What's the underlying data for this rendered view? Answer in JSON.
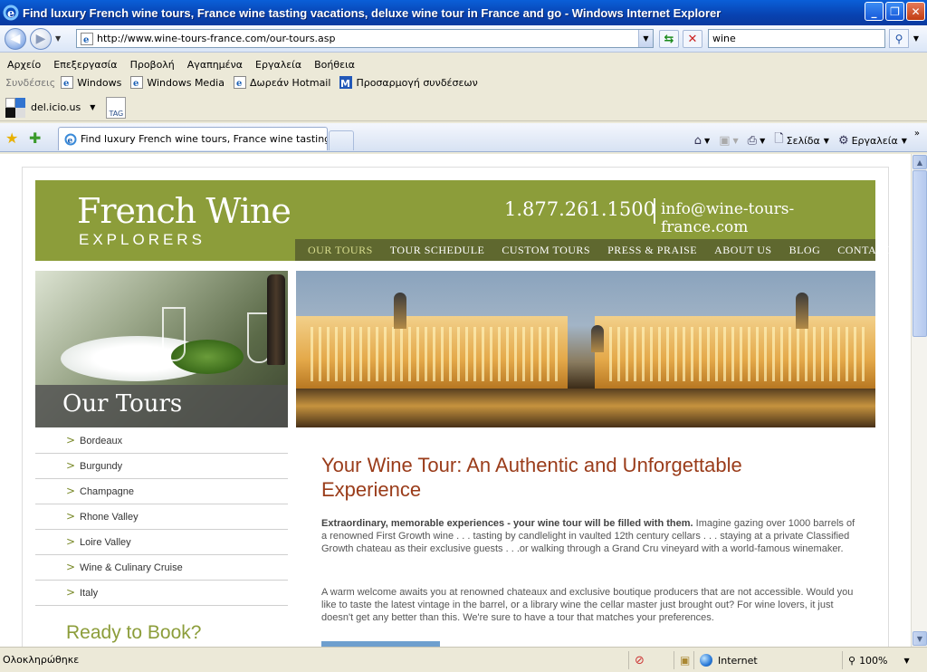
{
  "window": {
    "title": "Find luxury French wine tours, France wine tasting vacations, deluxe wine tour in France and go - Windows Internet Explorer",
    "minimize": "_",
    "maximize": "❐",
    "close": "✕"
  },
  "address": {
    "url": "http://www.wine-tours-france.com/our-tours.asp",
    "search_value": "wine"
  },
  "menu": [
    "Αρχείο",
    "Επεξεργασία",
    "Προβολή",
    "Αγαπημένα",
    "Εργαλεία",
    "Βοήθεια"
  ],
  "links_bar": {
    "label": "Συνδέσεις",
    "items": [
      "Windows",
      "Windows Media",
      "Δωρεάν Hotmail",
      "Προσαρμογή συνδέσεων"
    ]
  },
  "delicious": {
    "label": "del.icio.us",
    "tag": "TAG"
  },
  "tab": {
    "label": "Find luxury French wine tours, France wine tasting va..."
  },
  "toolbar": {
    "page": "Σελίδα",
    "tools": "Εργαλεία"
  },
  "site": {
    "logo_line1": "French Wine",
    "logo_line2": "EXPLORERS",
    "phone": "1.877.261.1500",
    "email": "info@wine-tours-france.com",
    "nav": [
      "OUR TOURS",
      "TOUR SCHEDULE",
      "CUSTOM TOURS",
      "PRESS & PRAISE",
      "ABOUT US",
      "BLOG",
      "CONTACT US"
    ],
    "banner_label": "Our Tours",
    "sidebar": [
      "Bordeaux",
      "Burgundy",
      "Champagne",
      "Rhone Valley",
      "Loire Valley",
      "Wine & Culinary Cruise",
      "Italy"
    ],
    "ready": "Ready to Book?",
    "main_title": "Your Wine Tour: An Authentic and Unforgettable Experience",
    "p1_bold": "Extraordinary, memorable experiences - your wine tour will be filled with them.",
    "p1_rest": " Imagine gazing over 1000 barrels of a renowned First Growth wine . . . tasting by candlelight in vaulted 12th century cellars . . . staying at a private Classified Growth chateau as their exclusive guests . . .or walking through a Grand Cru vineyard with a world-famous winemaker.",
    "p2": "A warm welcome awaits you at renowned chateaux and exclusive boutique producers that are not accessible. Would you like to taste the latest vintage in the barrel, or a library wine the cellar master just brought out? For wine lovers, it just doesn't get any better than this.  We're sure to have a tour that matches your preferences."
  },
  "status": {
    "text": "Ολοκληρώθηκε",
    "zone": "Internet",
    "zoom": "100%"
  },
  "colors": {
    "header_green": "#8c9d3a",
    "nav_dark": "#5f682f",
    "title_red": "#9a3c1a"
  }
}
